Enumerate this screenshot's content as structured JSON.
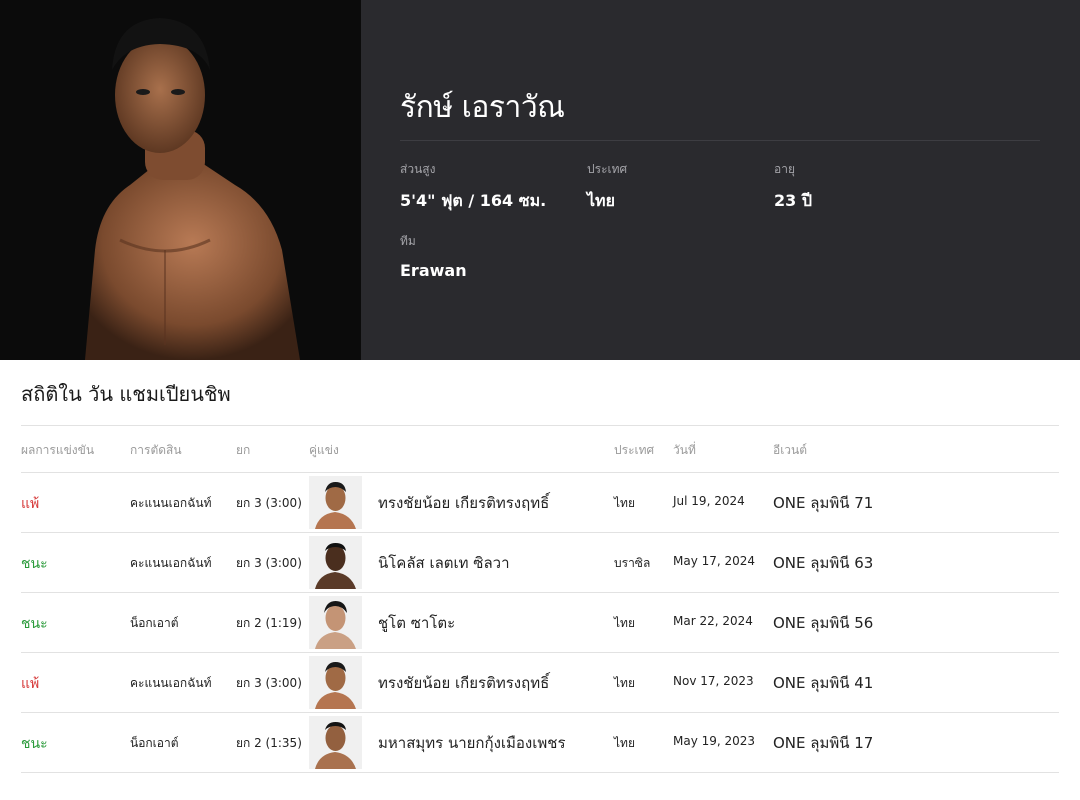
{
  "fighter": {
    "name": "รักษ์ เอราวัณ",
    "height_label": "ส่วนสูง",
    "height_value": "5'4\" ฟุต / 164 ซม.",
    "country_label": "ประเทศ",
    "country_value": "ไทย",
    "age_label": "อายุ",
    "age_value": "23 ปี",
    "team_label": "ทีม",
    "team_value": "Erawan"
  },
  "records": {
    "title": "สถิติใน วัน แชมเปียนชิพ",
    "headers": {
      "result": "ผลการแข่งขัน",
      "method": "การตัดสิน",
      "round": "ยก",
      "opponent": "คู่แข่ง",
      "country": "ประเทศ",
      "date": "วันที่",
      "event": "อีเวนต์"
    },
    "rows": [
      {
        "result": "แพ้",
        "outcome": "loss",
        "method": "คะแนนเอกฉันท์",
        "round": "ยก 3 (3:00)",
        "opponent": "ทรงชัยน้อย เกียรติทรงฤทธิ์",
        "country": "ไทย",
        "date": "Jul 19, 2024",
        "event": "ONE ลุมพินี 71"
      },
      {
        "result": "ชนะ",
        "outcome": "win",
        "method": "คะแนนเอกฉันท์",
        "round": "ยก 3 (3:00)",
        "opponent": "นิโคลัส เลตเท ซิลวา",
        "country": "บราซิล",
        "date": "May 17, 2024",
        "event": "ONE ลุมพินี 63"
      },
      {
        "result": "ชนะ",
        "outcome": "win",
        "method": "น็อกเอาต์",
        "round": "ยก 2 (1:19)",
        "opponent": "ชูโต ซาโตะ",
        "country": "ไทย",
        "date": "Mar 22, 2024",
        "event": "ONE ลุมพินี 56"
      },
      {
        "result": "แพ้",
        "outcome": "loss",
        "method": "คะแนนเอกฉันท์",
        "round": "ยก 3 (3:00)",
        "opponent": "ทรงชัยน้อย เกียรติทรงฤทธิ์",
        "country": "ไทย",
        "date": "Nov 17, 2023",
        "event": "ONE ลุมพินี 41"
      },
      {
        "result": "ชนะ",
        "outcome": "win",
        "method": "น็อกเอาต์",
        "round": "ยก 2 (1:35)",
        "opponent": "มหาสมุทร นายกกุ้งเมืองเพชร",
        "country": "ไทย",
        "date": "May 19, 2023",
        "event": "ONE ลุมพินี 17"
      }
    ]
  },
  "colors": {
    "loss": "#d63a3a",
    "win": "#2a9a3a",
    "hero_bg": "#2a2a2e"
  }
}
